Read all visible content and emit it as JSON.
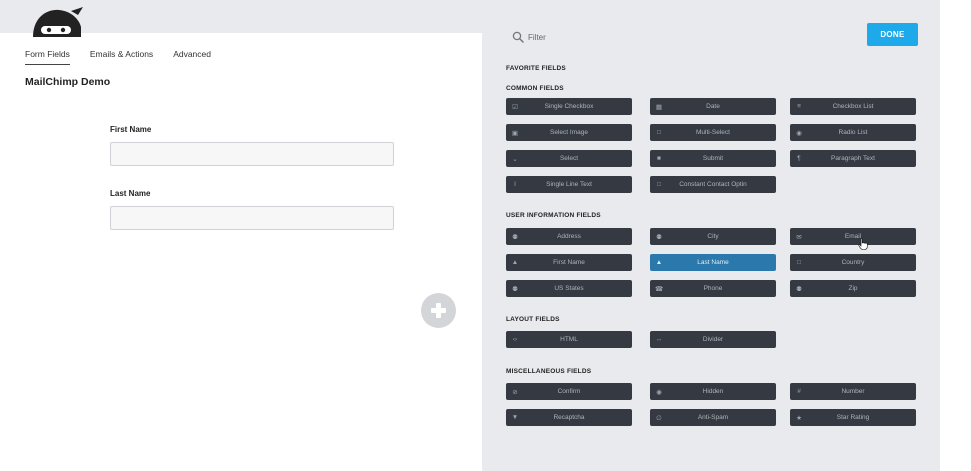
{
  "tabs": [
    "Form Fields",
    "Emails & Actions",
    "Advanced"
  ],
  "form_title": "MailChimp Demo",
  "fields": [
    {
      "label": "First Name",
      "value": ""
    },
    {
      "label": "Last Name",
      "value": ""
    }
  ],
  "drawer": {
    "filter_placeholder": "Filter",
    "done_label": "DONE",
    "sections": {
      "favorite": {
        "title": "FAVORITE FIELDS"
      },
      "common": {
        "title": "COMMON FIELDS",
        "items": [
          {
            "icon": "checkbox-icon",
            "label": "Single Checkbox"
          },
          {
            "icon": "calendar-icon",
            "label": "Date"
          },
          {
            "icon": "list-icon",
            "label": "Checkbox List"
          },
          {
            "icon": "image-icon",
            "label": "Select Image"
          },
          {
            "icon": "square-icon",
            "label": "Multi-Select"
          },
          {
            "icon": "radio-icon",
            "label": "Radio List"
          },
          {
            "icon": "chevron-down-icon",
            "label": "Select"
          },
          {
            "icon": "stop-icon",
            "label": "Submit"
          },
          {
            "icon": "paragraph-icon",
            "label": "Paragraph Text"
          },
          {
            "icon": "text-cursor-icon",
            "label": "Single Line Text"
          },
          {
            "icon": "square-icon",
            "label": "Constant Contact Optin"
          }
        ]
      },
      "user": {
        "title": "USER INFORMATION FIELDS",
        "items": [
          {
            "icon": "map-pin-icon",
            "label": "Address"
          },
          {
            "icon": "map-pin-icon",
            "label": "City"
          },
          {
            "icon": "envelope-icon",
            "label": "Email"
          },
          {
            "icon": "user-icon",
            "label": "First Name"
          },
          {
            "icon": "user-icon",
            "label": "Last Name"
          },
          {
            "icon": "square-icon",
            "label": "Country"
          },
          {
            "icon": "map-pin-icon",
            "label": "US States"
          },
          {
            "icon": "phone-icon",
            "label": "Phone"
          },
          {
            "icon": "map-pin-icon",
            "label": "Zip"
          }
        ]
      },
      "layout": {
        "title": "LAYOUT FIELDS",
        "items": [
          {
            "icon": "code-icon",
            "label": "HTML"
          },
          {
            "icon": "arrows-horizontal-icon",
            "label": "Divider"
          }
        ]
      },
      "misc": {
        "title": "MISCELLANEOUS FIELDS",
        "items": [
          {
            "icon": "check-circle-icon",
            "label": "Confirm"
          },
          {
            "icon": "eye-icon",
            "label": "Hidden"
          },
          {
            "icon": "hash-icon",
            "label": "Number"
          },
          {
            "icon": "filter-funnel-icon",
            "label": "Recaptcha"
          },
          {
            "icon": "ban-icon",
            "label": "Anti-Spam"
          },
          {
            "icon": "star-icon",
            "label": "Star Rating"
          }
        ]
      }
    }
  }
}
